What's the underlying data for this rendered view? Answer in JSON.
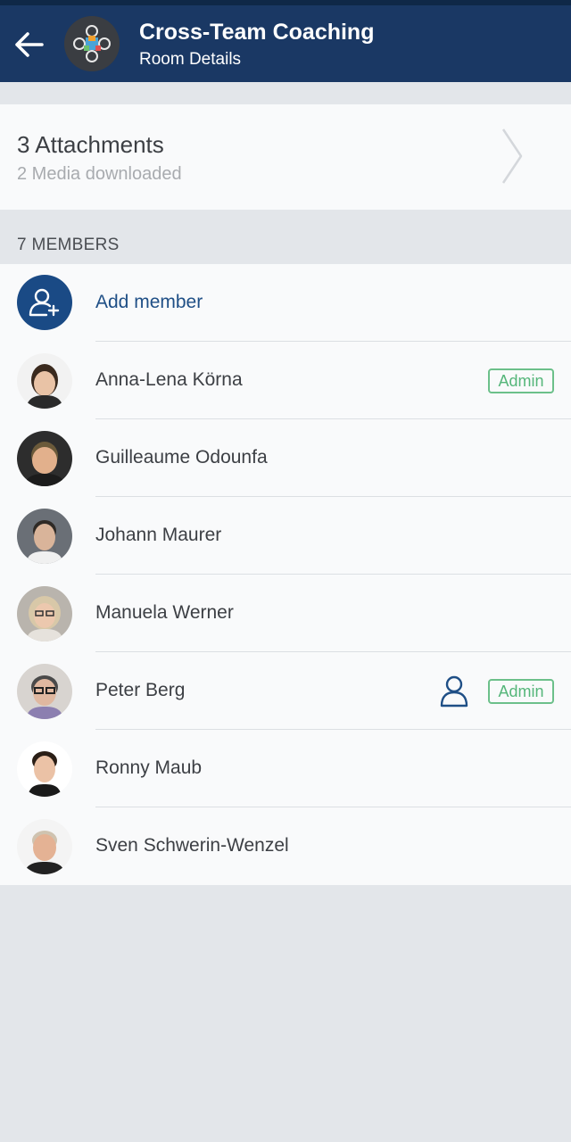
{
  "header": {
    "title": "Cross-Team Coaching",
    "subtitle": "Room Details",
    "back_icon": "arrow-left-icon",
    "room_avatar": "room-logo-image"
  },
  "attachments": {
    "title": "3 Attachments",
    "subtitle": "2 Media downloaded",
    "chevron_icon": "chevron-right-icon"
  },
  "members": {
    "header": "7 MEMBERS",
    "add_label": "Add member",
    "add_icon": "add-user-icon",
    "items": [
      {
        "name": "Anna-Lena Körna",
        "badge": "Admin",
        "hair": "#3a2a1e",
        "skin": "#e9c3a6",
        "bg": "#f2f2f2",
        "shirt": "#2a2a2a"
      },
      {
        "name": "Guilleaume Odounfa",
        "badge": "",
        "hair": "#6b5a3a",
        "skin": "#e2b08c",
        "bg": "#2d2d2d",
        "shirt": "#1c1c1c"
      },
      {
        "name": "Johann Maurer",
        "badge": "",
        "hair": "#2f2a26",
        "skin": "#d9b49a",
        "bg": "#6a6f76",
        "shirt": "#f0f0f0"
      },
      {
        "name": "Manuela Werner",
        "badge": "",
        "hair": "#d8c8a8",
        "skin": "#ecc8ae",
        "bg": "#b9b4ad",
        "shirt": "#e6e2dc"
      },
      {
        "name": "Peter Berg",
        "badge": "Admin",
        "hair": "#4a4a4a",
        "skin": "#e0b8a0",
        "bg": "#d8d4d0",
        "shirt": "#8c7fb0",
        "contact_icon": "person-outline-icon"
      },
      {
        "name": "Ronny Maub",
        "badge": "",
        "hair": "#2a1e16",
        "skin": "#ebc2a6",
        "bg": "#ffffff",
        "shirt": "#1a1a1a"
      },
      {
        "name": "Sven Schwerin-Wenzel",
        "badge": "",
        "hair": "#cfc3b0",
        "skin": "#e4b294",
        "bg": "#f4f4f4",
        "shirt": "#222222"
      }
    ]
  }
}
